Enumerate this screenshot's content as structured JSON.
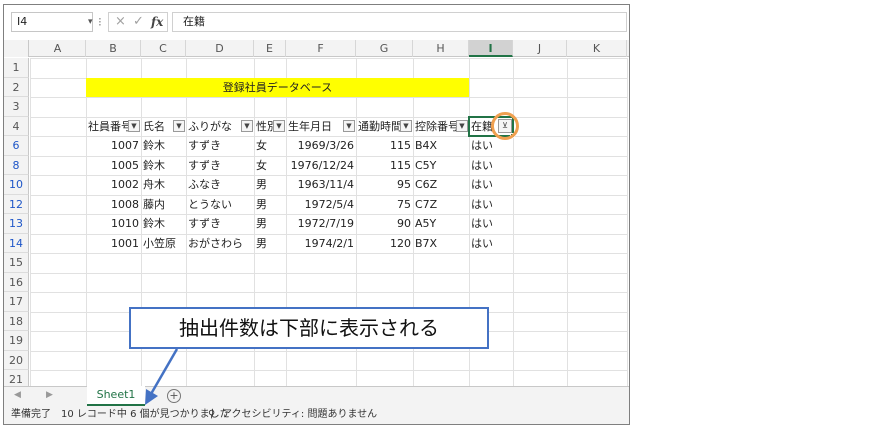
{
  "formula_bar": {
    "name_box": "I4",
    "separator": "⁝",
    "cancel_icon": "×",
    "enter_icon": "✓",
    "fx_label": "fx",
    "formula_value": "在籍"
  },
  "columns": [
    "A",
    "B",
    "C",
    "D",
    "E",
    "F",
    "G",
    "H",
    "I",
    "J",
    "K"
  ],
  "selected_column": "I",
  "row_numbers": [
    "1",
    "2",
    "3",
    "4",
    "6",
    "8",
    "10",
    "12",
    "13",
    "14",
    "15",
    "16",
    "17",
    "18",
    "19",
    "20",
    "21"
  ],
  "title": "登録社員データベース",
  "headers": [
    "社員番号",
    "氏名",
    "ふりがな",
    "性別",
    "生年月日",
    "通勤時間",
    "控除番号",
    "在籍"
  ],
  "rows": [
    [
      "1007",
      "鈴木",
      "すずき",
      "女",
      "1969/3/26",
      "115",
      "B4X",
      "はい"
    ],
    [
      "1005",
      "鈴木",
      "すずき",
      "女",
      "1976/12/24",
      "115",
      "C5Y",
      "はい"
    ],
    [
      "1002",
      "舟木",
      "ふなき",
      "男",
      "1963/11/4",
      "95",
      "C6Z",
      "はい"
    ],
    [
      "1008",
      "藤内",
      "とうない",
      "男",
      "1972/5/4",
      "75",
      "C7Z",
      "はい"
    ],
    [
      "1010",
      "鈴木",
      "すずき",
      "男",
      "1972/7/19",
      "90",
      "A5Y",
      "はい"
    ],
    [
      "1001",
      "小笠原",
      "おがさわら",
      "男",
      "1974/2/1",
      "120",
      "B7X",
      "はい"
    ]
  ],
  "filter_icon": "▼",
  "filter_active_icon": "⊻",
  "tabs": {
    "nav_prev": "◀",
    "nav_next": "▶",
    "sheet_name": "Sheet1",
    "add_icon": "+"
  },
  "status": {
    "ready": "準備完了",
    "count": "10 レコード中 6 個が見つかりました",
    "accessibility_icon": "⚲",
    "accessibility": "アクセシビリティ: 問題ありません"
  },
  "callout_text": "抽出件数は下部に表示される",
  "colors": {
    "excel_green": "#217346",
    "title_fill": "#ffff00",
    "filtered_row_number": "#1e56c8",
    "callout_border": "#4472c4",
    "highlight_circle": "#f0a050"
  }
}
